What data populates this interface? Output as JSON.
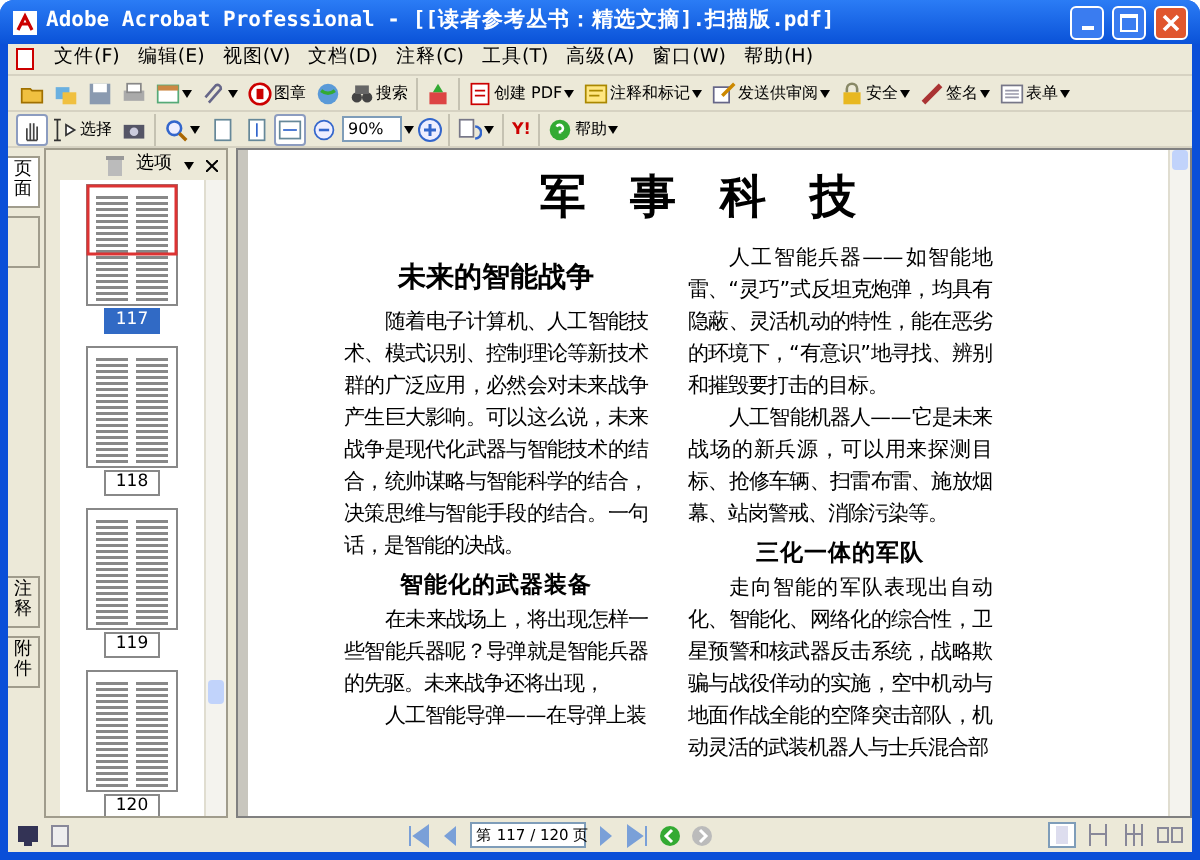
{
  "window": {
    "title": "Adobe Acrobat Professional - [[读者参考丛书：精选文摘].扫描版.pdf]"
  },
  "menu": [
    {
      "label": "文件(F)"
    },
    {
      "label": "编辑(E)"
    },
    {
      "label": "视图(V)"
    },
    {
      "label": "文档(D)"
    },
    {
      "label": "注释(C)"
    },
    {
      "label": "工具(T)"
    },
    {
      "label": "高级(A)"
    },
    {
      "label": "窗口(W)"
    },
    {
      "label": "帮助(H)"
    }
  ],
  "toolbar1": [
    {
      "items": [
        {
          "dropdown": false
        },
        {
          "dropdown": false
        },
        {
          "dropdown": false
        },
        {
          "dropdown": false
        },
        {
          "dropdown": true
        },
        {
          "dropdown": true
        },
        {
          "label": "图章",
          "dropdown": false
        },
        {
          "dropdown": false
        },
        {
          "label": "搜索",
          "dropdown": false
        }
      ]
    },
    {
      "items": [
        {
          "dropdown": false
        }
      ]
    },
    {
      "items": [
        {
          "label": "创建 PDF",
          "dropdown": true
        },
        {
          "label": "注释和标记",
          "dropdown": true
        },
        {
          "label": "发送供审阅",
          "dropdown": true
        },
        {
          "label": "安全",
          "dropdown": true
        },
        {
          "label": "签名",
          "dropdown": true
        },
        {
          "label": "表单",
          "dropdown": true
        }
      ]
    }
  ],
  "toolbar2": [
    {
      "items": [
        {
          "dropdown": false,
          "selected": true
        },
        {
          "label": "选择",
          "dropdown": false,
          "selected": false
        },
        {
          "dropdown": false,
          "selected": false
        }
      ]
    },
    {
      "items": [
        {
          "dropdown": true,
          "selected": false
        },
        {
          "dropdown": false,
          "selected": false
        },
        {
          "dropdown": false,
          "selected": false
        },
        {
          "dropdown": false,
          "selected": true
        },
        {
          "dropdown": false,
          "selected": false
        }
      ]
    },
    {
      "items": [
        {
          "dropdown": true,
          "selected": false
        }
      ]
    },
    {
      "items": [
        {
          "label": "Y!",
          "dropdown": false,
          "selected": false
        }
      ]
    },
    {
      "items": [
        {
          "label": "帮助",
          "dropdown": true,
          "selected": false
        }
      ]
    }
  ],
  "zoom": {
    "value": "90%"
  },
  "sidebar": {
    "tabs": [
      {
        "label": "页面",
        "selected": true
      },
      {
        "selected": false
      },
      {
        "label": "注释",
        "selected": false
      },
      {
        "label": "附件",
        "selected": false
      }
    ],
    "options_label": "选项",
    "thumbnails": [
      {
        "label": "117",
        "selected": true
      },
      {
        "label": "118",
        "selected": false
      },
      {
        "label": "119",
        "selected": false
      },
      {
        "label": "120",
        "selected": false
      }
    ]
  },
  "document": {
    "title": "军事科技",
    "left_column": [
      {
        "kind": "heading",
        "text": "未来的智能战争"
      },
      {
        "kind": "paragraph",
        "text": "随着电子计算机、人工智能技术、模式识别、控制理论等新技术群的广泛应用，必然会对未来战争产生巨大影响。可以这么说，未来战争是现代化武器与智能技术的结合，统帅谋略与智能科学的结合，决策思维与智能手段的结合。一句话，是智能的决战。"
      },
      {
        "kind": "subheading",
        "text": "智能化的武器装备"
      },
      {
        "kind": "paragraph",
        "text": "在未来战场上，将出现怎样一些智能兵器呢？导弹就是智能兵器的先驱。未来战争还将出现，"
      },
      {
        "kind": "paragraph",
        "text": "人工智能导弹——在导弹上装"
      }
    ],
    "right_column": [
      {
        "kind": "paragraph",
        "text": "人工智能兵器——如智能地雷、“灵巧”式反坦克炮弹，均具有隐蔽、灵活机动的特性，能在恶劣的环境下，“有意识”地寻找、辨别和摧毁要打击的目标。"
      },
      {
        "kind": "paragraph",
        "text": "人工智能机器人——它是未来战场的新兵源，可以用来探测目标、抢修车辆、扫雷布雷、施放烟幕、站岗警戒、消除污染等。"
      },
      {
        "kind": "subheading",
        "text": "三化一体的军队"
      },
      {
        "kind": "paragraph",
        "text": "走向智能的军队表现出自动化、智能化、网络化的综合性，卫星预警和核武器反击系统，战略欺骗与战役佯动的实施，空中机动与地面作战全能的空降突击部队，机动灵活的武装机器人与士兵混合部"
      }
    ]
  },
  "status_bar": {
    "page_field": "第 117 / 120 页",
    "back_enabled": true,
    "forward_enabled": false
  }
}
